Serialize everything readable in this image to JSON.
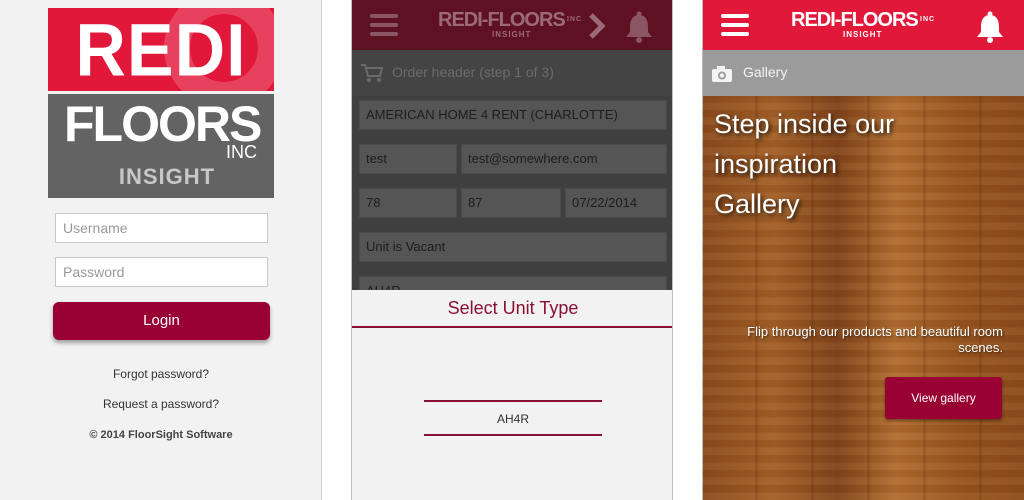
{
  "login": {
    "logo_top_text": "REDI",
    "logo_bottom_text": "FLOORS",
    "logo_inc": "INC",
    "logo_insight": "INSIGHT",
    "username_placeholder": "Username",
    "password_placeholder": "Password",
    "login_label": "Login",
    "forgot_password": "Forgot password?",
    "request_password": "Request a password?",
    "copyright": "© 2014 FloorSight Software"
  },
  "order": {
    "brand": "REDI-FLOORS",
    "brand_inc": "INC",
    "brand_insight": "INSIGHT",
    "step_title": "Order header (step 1 of 3)",
    "customer": "AMERICAN HOME 4 RENT (CHARLOTTE)",
    "contact_name": "test",
    "contact_email": "test@somewhere.com",
    "field_a": "78",
    "field_b": "87",
    "date": "07/22/2014",
    "occupancy": "Unit is Vacant",
    "unit_type_partial": "AH4R",
    "modal_title": "Select Unit Type",
    "picker_value": "AH4R"
  },
  "gallery": {
    "brand": "REDI-FLOORS",
    "brand_inc": "INC",
    "brand_insight": "INSIGHT",
    "bar_title": "Gallery",
    "hero_line1": "Step inside our",
    "hero_line2": "inspiration",
    "hero_line3": "Gallery",
    "subtitle": "Flip through our products and beautiful room scenes.",
    "button_label": "View gallery"
  },
  "colors": {
    "brand_red": "#e2183b",
    "brand_maroon": "#990033",
    "brand_gray": "#636363"
  },
  "icons": [
    "hamburger-menu-icon",
    "bell-icon",
    "cart-icon",
    "camera-icon",
    "chevron-right-icon"
  ]
}
